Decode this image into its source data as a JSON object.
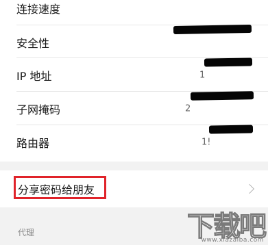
{
  "settings": {
    "rows": [
      {
        "label": "连接速度"
      },
      {
        "label": "安全性"
      },
      {
        "label": "IP 地址",
        "value_prefix": "1"
      },
      {
        "label": "子网掩码",
        "value_prefix": "2"
      },
      {
        "label": "路由器",
        "value_prefix": "1!"
      }
    ],
    "share": {
      "label": "分享密码给朋友"
    },
    "proxy_section": {
      "label": "代理"
    }
  },
  "watermark": {
    "chars": "下载吧",
    "url": "www.xiazaiba.com"
  },
  "colors": {
    "background": "#f2f2f2",
    "highlight": "#e0232a",
    "redaction": "#050505"
  }
}
